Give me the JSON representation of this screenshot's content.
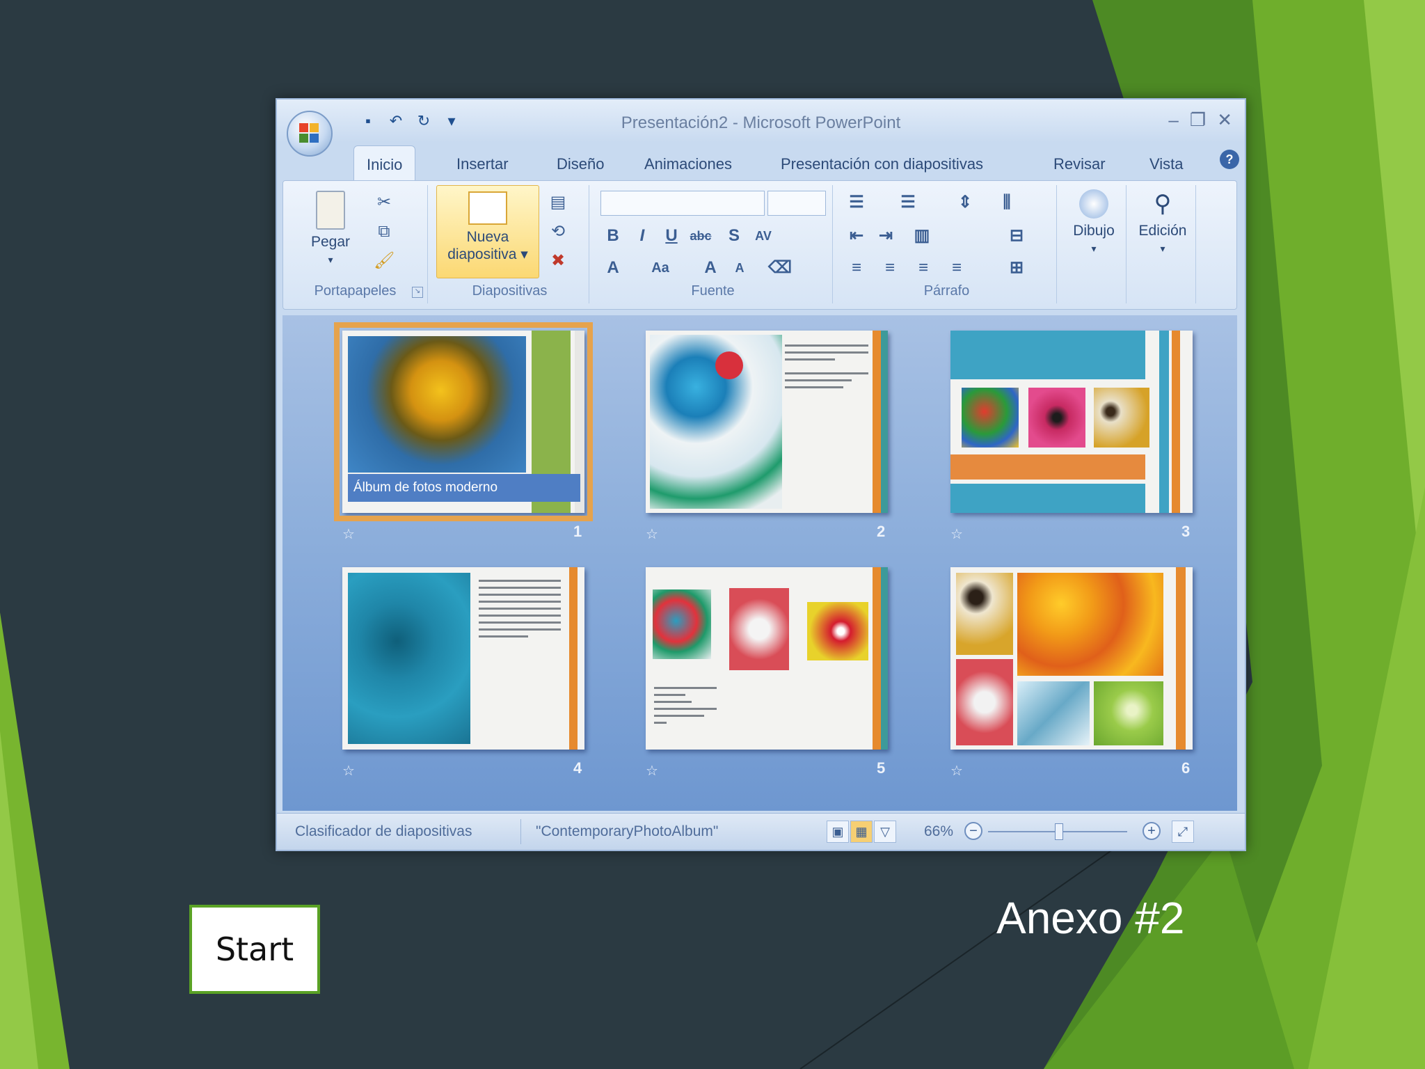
{
  "window": {
    "title": "Presentación2 - Microsoft PowerPoint"
  },
  "ribbon": {
    "tabs": [
      "Inicio",
      "Insertar",
      "Diseño",
      "Animaciones",
      "Presentación con diapositivas",
      "Revisar",
      "Vista"
    ],
    "active_tab": "Inicio",
    "groups": {
      "clipboard": {
        "label": "Portapapeles",
        "paste": "Pegar"
      },
      "slides": {
        "label": "Diapositivas",
        "new_slide_line1": "Nueva",
        "new_slide_line2": "diapositiva"
      },
      "font": {
        "label": "Fuente"
      },
      "paragraph": {
        "label": "Párrafo"
      },
      "drawing": {
        "label": "Dibujo"
      },
      "editing": {
        "label": "Edición"
      }
    }
  },
  "slides": [
    {
      "number": "1",
      "caption": "Álbum de fotos moderno"
    },
    {
      "number": "2"
    },
    {
      "number": "3"
    },
    {
      "number": "4"
    },
    {
      "number": "5"
    },
    {
      "number": "6"
    }
  ],
  "status": {
    "view": "Clasificador de diapositivas",
    "theme": "\"ContemporaryPhotoAlbum\"",
    "zoom": "66%"
  },
  "slide_text": {
    "annex": "Anexo #2",
    "start_button": "Start"
  },
  "colors": {
    "slide_background": "#2b3a42",
    "accent_green": "#7ab52f",
    "selection_orange": "#e6a34d",
    "ribbon_blue": "#c8daf0"
  }
}
